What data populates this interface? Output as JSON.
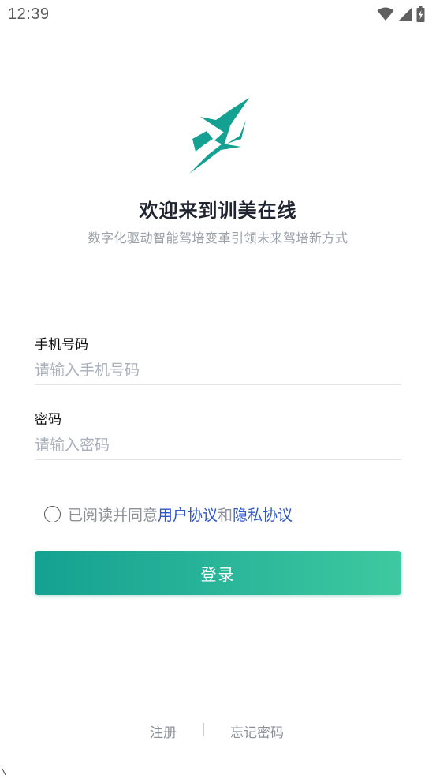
{
  "status_bar": {
    "time": "12:39",
    "icons": [
      "wifi-icon",
      "cellular-signal-icon",
      "battery-charging-icon"
    ]
  },
  "branding": {
    "logo_icon": "xunmei-logo-icon",
    "logo_color": "#14a191",
    "title": "欢迎来到训美在线",
    "subtitle": "数字化驱动智能驾培变革引领未来驾培新方式"
  },
  "form": {
    "phone": {
      "label": "手机号码",
      "placeholder": "请输入手机号码",
      "value": ""
    },
    "password": {
      "label": "密码",
      "placeholder": "请输入密码",
      "value": ""
    }
  },
  "agreement": {
    "checked": false,
    "prefix": "已阅读并同意",
    "user_agreement": "用户协议",
    "conjunction": "和",
    "privacy_agreement": "隐私协议",
    "link_color": "#2e57c9"
  },
  "login_button": {
    "label": "登录",
    "gradient": [
      "#14a191",
      "#3ec9a0"
    ]
  },
  "footer": {
    "register": "注册",
    "divider": "|",
    "forgot_password": "忘记密码"
  }
}
